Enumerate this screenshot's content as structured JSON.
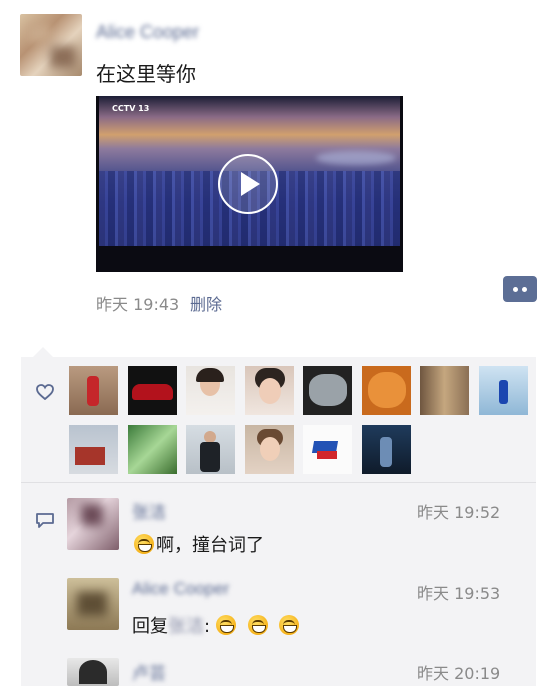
{
  "post": {
    "author_name": "Alice Cooper",
    "text": "在这里等你",
    "video": {
      "channel_logo": "CCTV 13"
    },
    "time": "昨天 19:43",
    "delete_label": "删除"
  },
  "likes": {
    "icon": "heart-outline-icon",
    "thumbs": [
      {
        "name": "girl-red-dress"
      },
      {
        "name": "red-car"
      },
      {
        "name": "girl-portrait"
      },
      {
        "name": "girl-selfie"
      },
      {
        "name": "cat"
      },
      {
        "name": "orange-cat"
      },
      {
        "name": "train-window"
      },
      {
        "name": "blue-dress-girl"
      },
      {
        "name": "red-barn"
      },
      {
        "name": "waterfall"
      },
      {
        "name": "man-dark-coat"
      },
      {
        "name": "girl-smile"
      },
      {
        "name": "toy-figure"
      },
      {
        "name": "movie-poster"
      }
    ]
  },
  "comments": [
    {
      "name": "张洁",
      "time": "昨天 19:52",
      "text": "啊，撞台词了"
    },
    {
      "name": "Alice Cooper",
      "time": "昨天 19:53",
      "reply_prefix": "回复",
      "reply_target": "张洁",
      "reply_suffix": ":"
    },
    {
      "name": "卢芸",
      "time": "昨天 20:19"
    }
  ],
  "colors": {
    "link": "#5b6a91",
    "panel": "#f3f3f5",
    "more_button": "#5c6e95"
  }
}
